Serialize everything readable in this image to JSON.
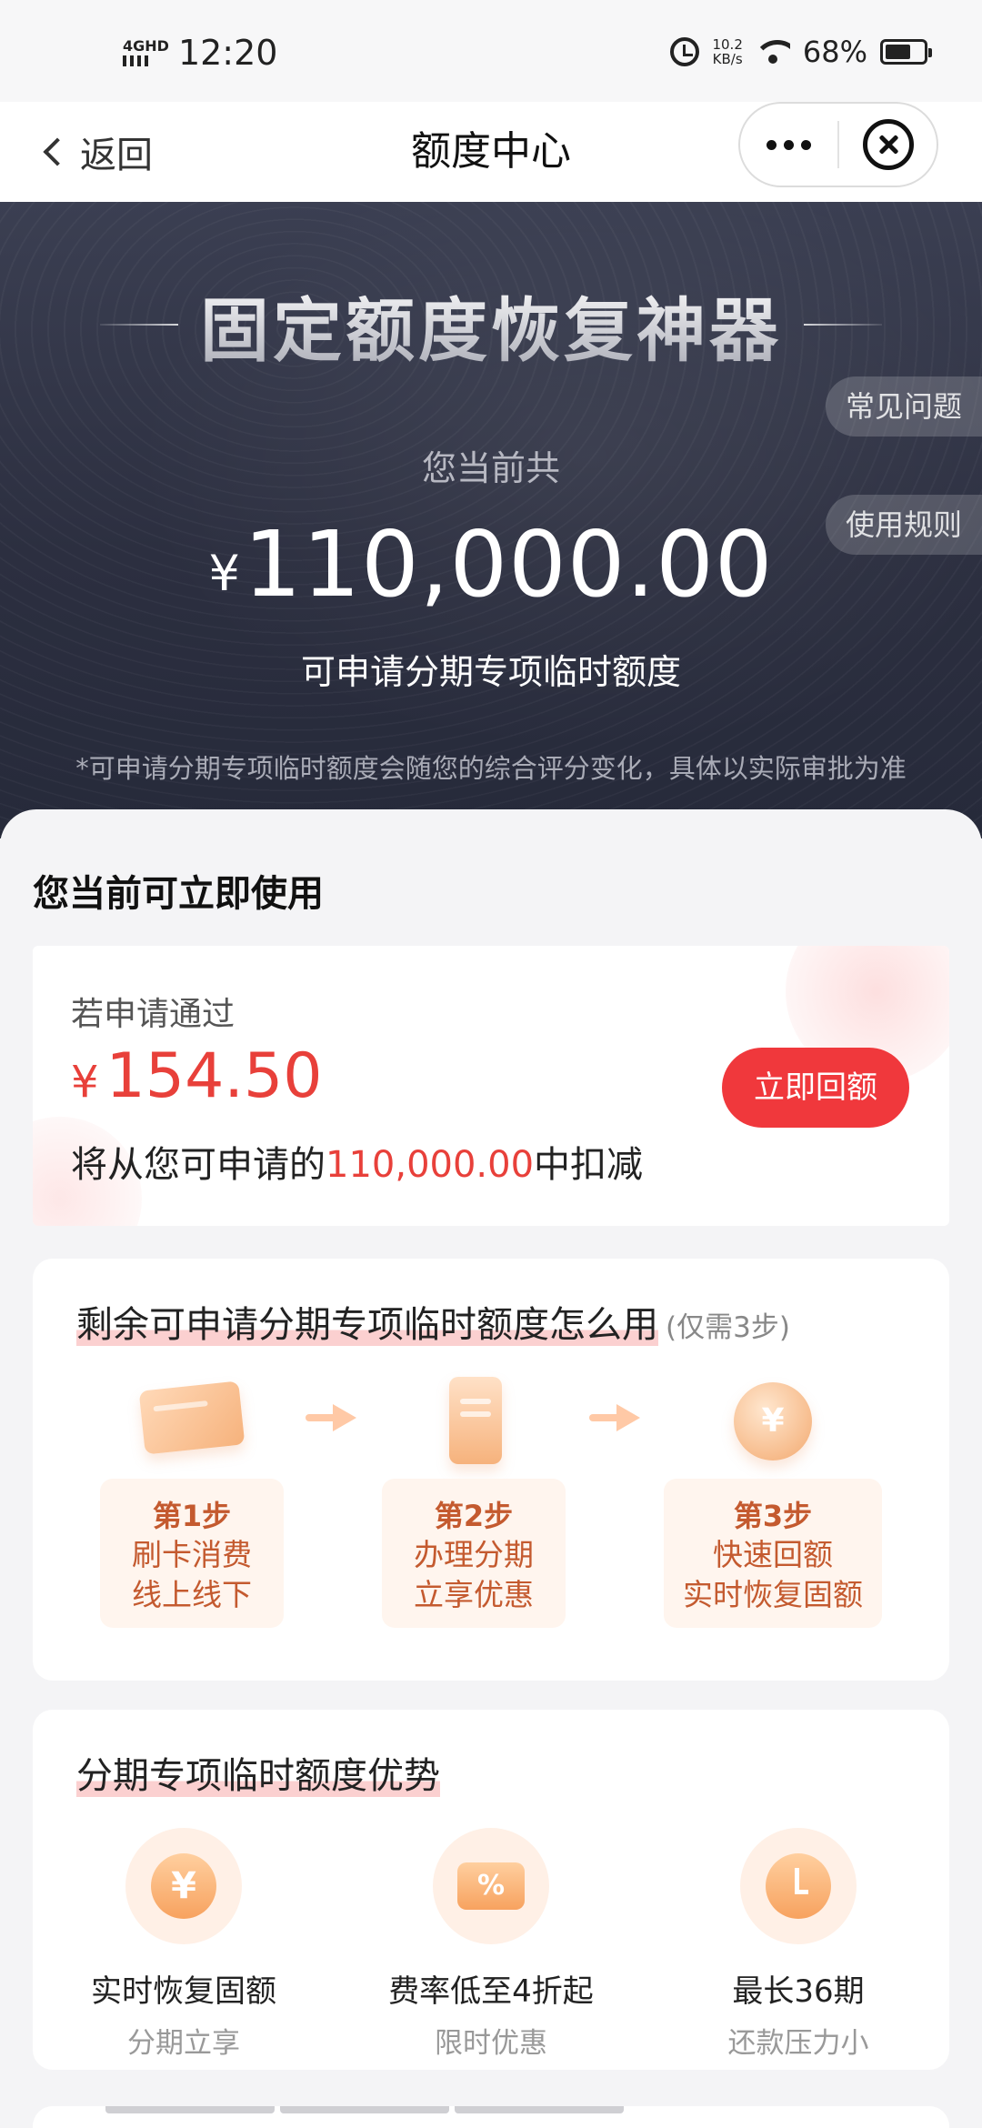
{
  "status_bar": {
    "network": "4GHD",
    "time": "12:20",
    "speed_value": "10.2",
    "speed_unit": "KB/s",
    "battery_percent": "68%",
    "battery_level": 0.68
  },
  "nav": {
    "back_label": "返回",
    "title": "额度中心"
  },
  "hero": {
    "title": "固定额度恢复神器",
    "faq_label": "常见问题",
    "rules_label": "使用规则",
    "subtitle": "您当前共",
    "currency": "¥",
    "amount": "110,000.00",
    "description": "可申请分期专项临时额度",
    "note": "*可申请分期专项临时额度会随您的综合评分变化，具体以实际审批为准"
  },
  "available": {
    "heading": "您当前可立即使用",
    "if_approved": "若申请通过",
    "currency": "¥",
    "amount": "154.50",
    "deduct_prefix": "将从您可申请的",
    "deduct_amount": "110,000.00",
    "deduct_suffix": "中扣减",
    "button_label": "立即回额"
  },
  "howto": {
    "title": "剩余可申请分期专项临时额度怎么用",
    "hint": "(仅需3步)",
    "steps": [
      {
        "name": "第1步",
        "line1": "刷卡消费",
        "line2": "线上线下",
        "icon": "credit-card-icon"
      },
      {
        "name": "第2步",
        "line1": "办理分期",
        "line2": "立享优惠",
        "icon": "phone-icon"
      },
      {
        "name": "第3步",
        "line1": "快速回额",
        "line2": "实时恢复固额",
        "icon": "coin-stack-icon"
      }
    ]
  },
  "advantages": {
    "title": "分期专项临时额度优势",
    "items": [
      {
        "title": "实时恢复固额",
        "subtitle": "分期立享",
        "glyph": "¥",
        "icon": "yen-icon"
      },
      {
        "title": "费率低至4折起",
        "subtitle": "限时优惠",
        "glyph": "%",
        "icon": "discount-ticket-icon"
      },
      {
        "title": "最长36期",
        "subtitle": "还款压力小",
        "glyph": "",
        "icon": "clock-icon"
      }
    ]
  },
  "colors": {
    "accent_red": "#f0383c",
    "amount_red": "#e8403a",
    "step_orange": "#c45a2f",
    "hero_bg": "#2c2f40"
  }
}
